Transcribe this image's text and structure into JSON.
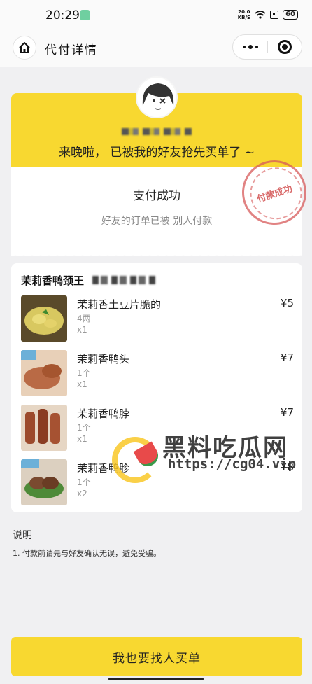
{
  "status_bar": {
    "time": "20:29",
    "net_speed_value": "20.0",
    "net_speed_unit": "KB/S",
    "battery": "60"
  },
  "nav": {
    "title": "代付详情"
  },
  "result": {
    "banner_text": "来晚啦， 已被我的好友抢先买单了 ~",
    "title": "支付成功",
    "subtitle": "好友的订单已被 别人付款",
    "stamp_text": "付款成功"
  },
  "order": {
    "shop_name": "茉莉香鸭颈王",
    "items": [
      {
        "name": "茉莉香土豆片脆的",
        "spec": "4两",
        "qty": "x1",
        "price": "¥5",
        "thumb_color": "#d8c860"
      },
      {
        "name": "茉莉香鸭头",
        "spec": "1个",
        "qty": "x1",
        "price": "¥7",
        "thumb_color": "#b96a45"
      },
      {
        "name": "茉莉香鸭脖",
        "spec": "1个",
        "qty": "x1",
        "price": "¥7",
        "thumb_color": "#9c4a2c"
      },
      {
        "name": "茉莉香鸭胗",
        "spec": "1个",
        "qty": "x2",
        "price": "¥8",
        "thumb_color": "#7a4a30"
      }
    ]
  },
  "notes": {
    "title": "说明",
    "text": "1. 付款前请先与好友确认无误，避免受骗。"
  },
  "watermark": {
    "title": "黑料吃瓜网",
    "url": "https://cg04.vip"
  },
  "bottom_button": {
    "label": "我也要找人买单"
  },
  "colors": {
    "accent_yellow": "#f8d830",
    "stamp_red": "#d75a5a"
  }
}
